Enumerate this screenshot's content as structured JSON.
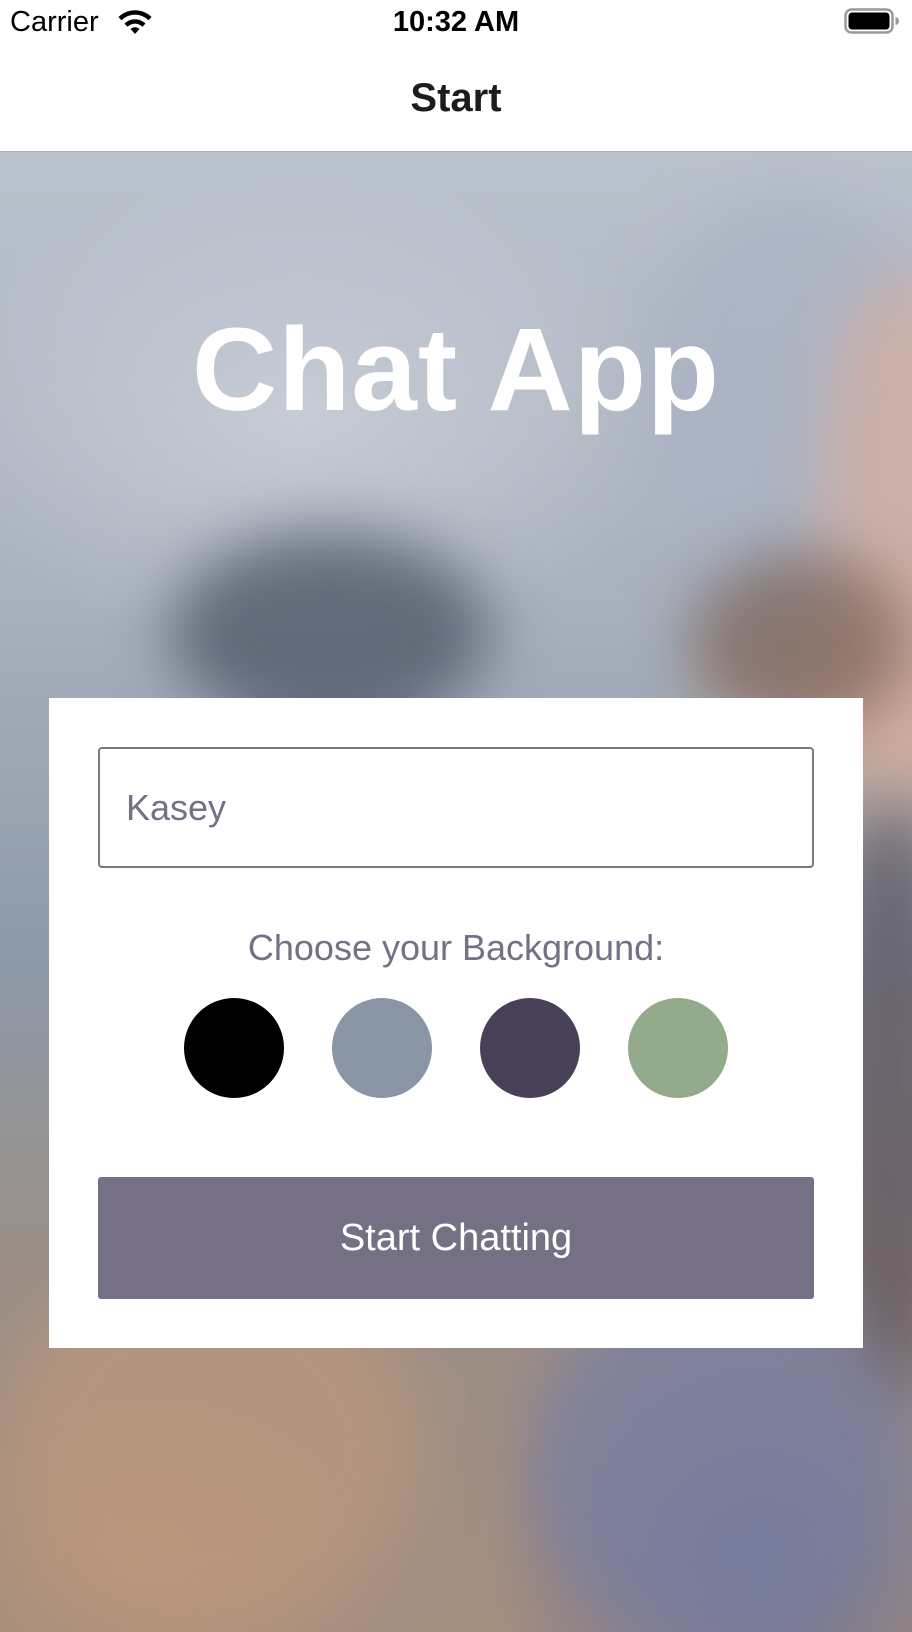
{
  "status_bar": {
    "carrier": "Carrier",
    "time": "10:32 AM",
    "wifi_icon": "wifi-icon",
    "battery_icon": "battery-full-icon"
  },
  "nav": {
    "title": "Start"
  },
  "hero": {
    "app_title": "Chat App"
  },
  "form": {
    "name_field": {
      "placeholder": "Kasey",
      "value": ""
    },
    "background_label": "Choose your Background:",
    "background_options": [
      {
        "name": "black",
        "color": "#000000"
      },
      {
        "name": "slate-gray",
        "color": "#8A95A5"
      },
      {
        "name": "dark-purple",
        "color": "#474056"
      },
      {
        "name": "sage-green",
        "color": "#93AB8A"
      }
    ],
    "start_button_label": "Start Chatting"
  },
  "colors": {
    "button_bg": "#757083",
    "label_text": "#757083",
    "title_text": "#FFFFFF"
  }
}
